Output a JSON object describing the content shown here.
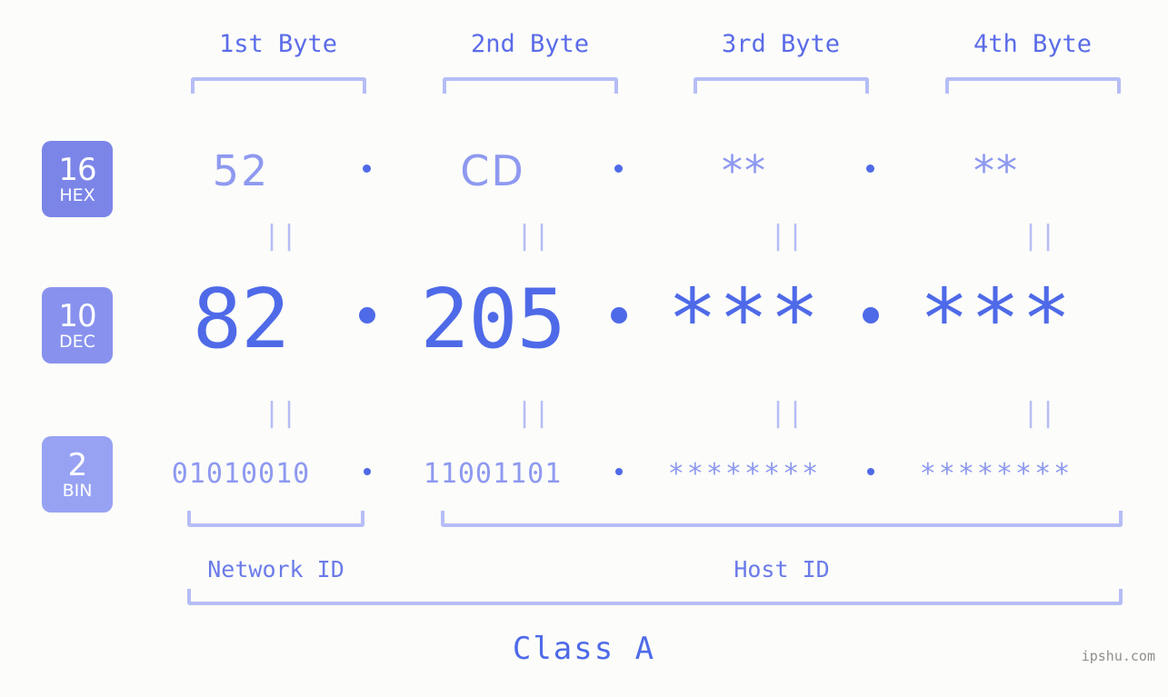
{
  "meta": {
    "watermark": "ipshu.com",
    "background_color": "#fcfdfa",
    "accent_color": "#4f6ae8",
    "muted_accent_color": "#8e99f0",
    "bracket_color": "#b6bdf6"
  },
  "byte_headers": [
    {
      "label": "1st Byte"
    },
    {
      "label": "2nd Byte"
    },
    {
      "label": "3rd Byte"
    },
    {
      "label": "4th Byte"
    }
  ],
  "bases": [
    {
      "key": "hex",
      "number": "16",
      "name": "HEX",
      "color": "#7b85e8"
    },
    {
      "key": "dec",
      "number": "10",
      "name": "DEC",
      "color": "#8892ee"
    },
    {
      "key": "bin",
      "number": "2",
      "name": "BIN",
      "color": "#97a2f3"
    }
  ],
  "rows": {
    "hex": {
      "values": [
        "52",
        "CD",
        "**",
        "**"
      ],
      "separator": "dot-icon"
    },
    "dec": {
      "values": [
        "82",
        "205",
        "***",
        "***"
      ],
      "separator": "dot-icon"
    },
    "bin": {
      "values": [
        "01010010",
        "11001101",
        "********",
        "********"
      ],
      "separator": "dot-icon"
    }
  },
  "connectors": {
    "symbol": "||",
    "count_per_row": 4
  },
  "segments": [
    {
      "label": "Network ID"
    },
    {
      "label": "Host ID"
    }
  ],
  "class": {
    "label": "Class A"
  }
}
